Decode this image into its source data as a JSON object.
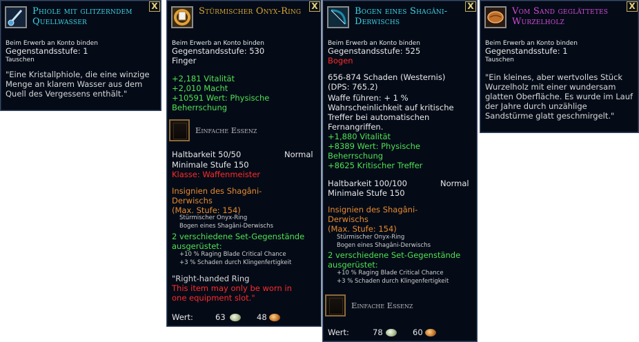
{
  "close_glyph": "X",
  "phiole": {
    "title": "Phiole mit glitzerndem Quellwasser",
    "bind": "Beim Erwerb an Konto binden",
    "level": "Gegenstandsstufe: 1",
    "trade": "Tauschen",
    "quote": "\"Eine Kristallphiole, die eine winzige Menge an klarem Wasser aus dem Quell des Vergessens enthält.\"",
    "icon": "vial-icon"
  },
  "ring": {
    "title": "Stürmischer Onyx-Ring",
    "bind": "Beim Erwerb an Konto binden",
    "level": "Gegenstandsstufe: 530",
    "slot": "Finger",
    "stats": [
      "+2,181 Vitalität",
      "+2,010 Macht",
      "+10591 Wert: Physische",
      "Beherrschung"
    ],
    "essence": "Einfache Essenz",
    "durability": "Haltbarkeit 50/50",
    "quality": "Normal",
    "min_level": "Minimale Stufe 150",
    "class": "Klasse: Waffenmeister",
    "set_name": [
      "Insignien des Shagâni-",
      "Derwischs"
    ],
    "set_max": "(Max. Stufe: 154)",
    "set_items": [
      "Stürmischer Onyx-Ring",
      "Bogen eines Shagâni-Derwischs"
    ],
    "set_bonus_head": [
      "2 verschiedene Set-Gegenstände",
      "ausgerüstet:"
    ],
    "set_bonuses": [
      "+10 % Raging Blade Critical Chance",
      "+3 % Schaden durch Klingenfertigkeit"
    ],
    "note": "\"Right-handed Ring",
    "warning": [
      "This item may only be worn in",
      "one equipment slot.\""
    ],
    "worth_label": "Wert:",
    "silver": "63",
    "copper": "48",
    "icon": "ring-icon"
  },
  "bow": {
    "title": "Bogen eines Shagâni-Derwischs",
    "bind": "Beim Erwerb an Konto binden",
    "level": "Gegenstandsstufe: 525",
    "type": "Bogen",
    "damage": "656-874 Schaden (Westernis)",
    "dps": "(DPS: 765.2)",
    "proc": [
      "Waffe führen: + 1 %",
      "Wahrscheinlichkeit auf kritische",
      "Treffer bei automatischen",
      "Fernangriffen."
    ],
    "stats": [
      "+1,880 Vitalität",
      "+8389 Wert: Physische",
      "Beherrschung",
      "+8625 Kritischer Treffer"
    ],
    "durability": "Haltbarkeit 100/100",
    "quality": "Normal",
    "min_level": "Minimale Stufe 150",
    "set_name": [
      "Insignien des Shagâni-",
      "Derwischs"
    ],
    "set_max": "(Max. Stufe: 154)",
    "set_items": [
      "Stürmischer Onyx-Ring",
      "Bogen eines Shagâni-Derwischs"
    ],
    "set_bonus_head": [
      "2 verschiedene Set-Gegenstände",
      "ausgerüstet:"
    ],
    "set_bonuses": [
      "+10 % Raging Blade Critical Chance",
      "+3 % Schaden durch Klingenfertigkeit"
    ],
    "essence": "Einfache Essenz",
    "worth_label": "Wert:",
    "silver": "78",
    "copper": "60",
    "icon": "bow-icon"
  },
  "wood": {
    "title": "Vom Sand geglättetes Wurzelholz",
    "bind": "Beim Erwerb an Konto binden",
    "level": "Gegenstandsstufe: 1",
    "trade": "Tauschen",
    "quote": "\"Ein kleines, aber wertvolles Stück Wurzelholz mit einer wundersam glatten Oberfläche. Es wurde im Lauf der Jahre durch unzählige Sandstürme glatt geschmirgelt.\"",
    "icon": "root-wood-icon"
  },
  "colors": {
    "panel_bg": "#040b17",
    "green": "#52e052",
    "red": "#ff2b2b",
    "orange": "#e88a2e",
    "title_cyan": "#3fd2e4",
    "title_gold": "#d9a531",
    "title_magenta": "#d24ad6"
  }
}
